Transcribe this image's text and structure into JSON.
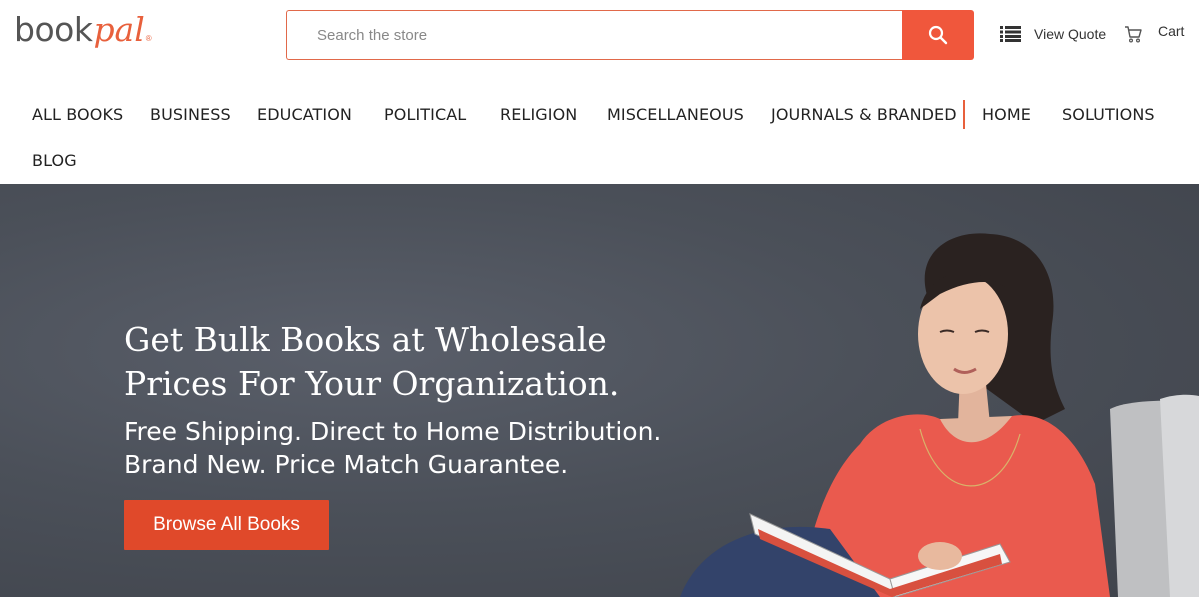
{
  "header": {
    "logo": {
      "part1": "book",
      "part2": "pal",
      "mark": "®"
    },
    "search": {
      "placeholder": "Search the store",
      "icon": "search-icon"
    },
    "quote": {
      "label": "View Quote",
      "icon": "list-icon"
    },
    "cart": {
      "label": "Cart",
      "icon": "cart-icon"
    }
  },
  "nav": {
    "items": [
      {
        "label": "ALL BOOKS"
      },
      {
        "label": "BUSINESS"
      },
      {
        "label": "EDUCATION"
      },
      {
        "label": "POLITICAL"
      },
      {
        "label": "RELIGION"
      },
      {
        "label": "MISCELLANEOUS"
      },
      {
        "label": "JOURNALS & BRANDED"
      },
      {
        "label": "HOME"
      },
      {
        "label": "SOLUTIONS"
      },
      {
        "label": "BLOG"
      }
    ]
  },
  "hero": {
    "title_line1": "Get Bulk Books at Wholesale",
    "title_line2": "Prices For Your Organization.",
    "sub_line1": "Free Shipping. Direct to Home Distribution.",
    "sub_line2": "Brand New. Price Match Guarantee.",
    "button": "Browse All Books"
  },
  "colors": {
    "accent": "#f0573c",
    "button": "#e0492a",
    "hero_bg": "#4b5059"
  }
}
